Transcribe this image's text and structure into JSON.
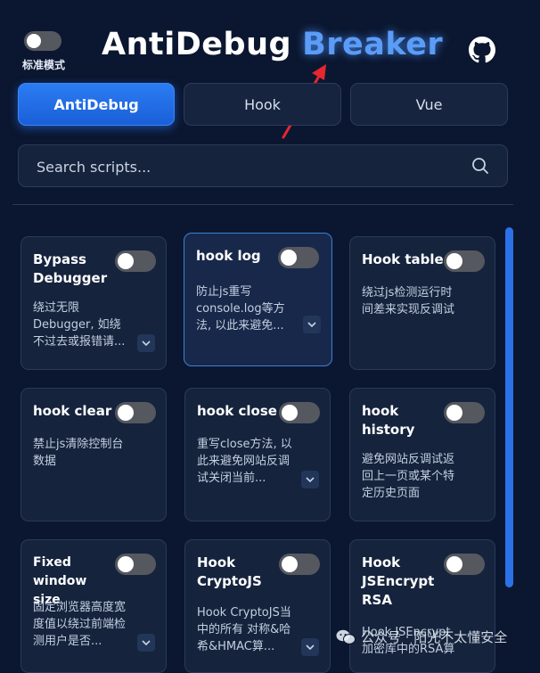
{
  "header": {
    "mode_label": "标准模式",
    "title_part1": "AntiDebug",
    "title_part2": "Breaker",
    "mode_toggle_on": false
  },
  "tabs": [
    {
      "label": "AntiDebug",
      "active": true
    },
    {
      "label": "Hook",
      "active": false
    },
    {
      "label": "Vue",
      "active": false
    }
  ],
  "search": {
    "placeholder": "Search scripts...",
    "value": ""
  },
  "cards": [
    {
      "title": "Bypass Debugger",
      "desc": "绕过无限Debugger, 如绕不过去或报错请...",
      "enabled": false
    },
    {
      "title": "hook log",
      "desc": "防止js重写console.log等方法, 以此来避免...",
      "enabled": false
    },
    {
      "title": "Hook table",
      "desc": "绕过js检测运行时间差来实现反调试",
      "enabled": false
    },
    {
      "title": "hook clear",
      "desc": "禁止js清除控制台数据",
      "enabled": false
    },
    {
      "title": "hook close",
      "desc": "重写close方法, 以此来避免网站反调试关闭当前...",
      "enabled": false
    },
    {
      "title": "hook history",
      "desc": "避免网站反调试返回上一页或某个特定历史页面",
      "enabled": false
    },
    {
      "title": "Fixed window size",
      "desc": "固定浏览器高度宽度值以绕过前端检测用户是否...",
      "enabled": false
    },
    {
      "title": "Hook CryptoJS",
      "desc": "Hook CryptoJS当中的所有 对称&哈希&HMAC算...",
      "enabled": false
    },
    {
      "title": "Hook JSEncrypt RSA",
      "desc": "Hook JSEncrypt加密库中的RSA算",
      "enabled": false
    }
  ],
  "watermark": {
    "text": "公众号 · 阳光不太懂安全"
  },
  "icons": {
    "github": "github-icon",
    "search": "search-icon",
    "expand": "chevron-down-icon",
    "watermark": "wechat-icon"
  },
  "colors": {
    "background": "#0b1730",
    "card": "#15233d",
    "accent": "#2b7cf3",
    "title_highlight": "#5b9cf7",
    "annotation_arrow": "#e5272e"
  }
}
